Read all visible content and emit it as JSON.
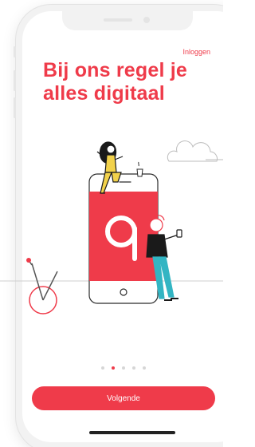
{
  "header": {
    "login_label": "Inloggen"
  },
  "hero": {
    "headline": "Bij ons regel je alles digitaal"
  },
  "illustration": {
    "logo_letter": "q"
  },
  "pager": {
    "total": 5,
    "active_index": 1
  },
  "footer": {
    "next_label": "Volgende"
  },
  "colors": {
    "brand": "#ef3b4a",
    "button_text": "#ffffff",
    "dot_inactive": "#d6d6d6"
  },
  "icons": [
    "cloud-icon",
    "bicycle-icon",
    "coffee-cup-icon",
    "phone-icon"
  ]
}
